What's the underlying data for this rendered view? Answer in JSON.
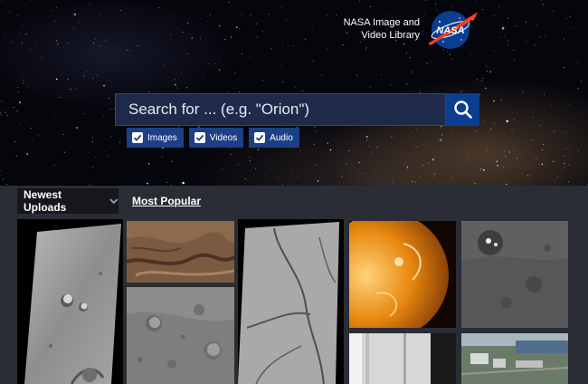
{
  "brand": {
    "line1": "NASA Image and",
    "line2": "Video Library",
    "logo_text": "NASA",
    "logo_icon": "nasa-meatball-icon"
  },
  "search": {
    "placeholder": "Search for ... (e.g. \"Orion\")",
    "button_icon": "search-icon"
  },
  "filters": [
    {
      "label": "Images",
      "checked": true
    },
    {
      "label": "Videos",
      "checked": true
    },
    {
      "label": "Audio",
      "checked": true
    }
  ],
  "sort": {
    "selected": "Newest Uploads",
    "alternate": "Most Popular"
  },
  "gallery": {
    "tiles": [
      {
        "name": "mars-surface-craters"
      },
      {
        "name": "mars-terrain-color"
      },
      {
        "name": "cratered-gray-surface"
      },
      {
        "name": "fractured-surface"
      },
      {
        "name": "sun-ultraviolet"
      },
      {
        "name": "ceres-surface"
      },
      {
        "name": "saturn-rings-closeup"
      },
      {
        "name": "aerial-facility-photo"
      }
    ]
  },
  "colors": {
    "nasa_blue": "#0b3d91",
    "nasa_red": "#fc3d21",
    "filter_blue": "#1d3f86",
    "search_bg": "#1f2a4a",
    "page_bg": "#2a2d35"
  }
}
